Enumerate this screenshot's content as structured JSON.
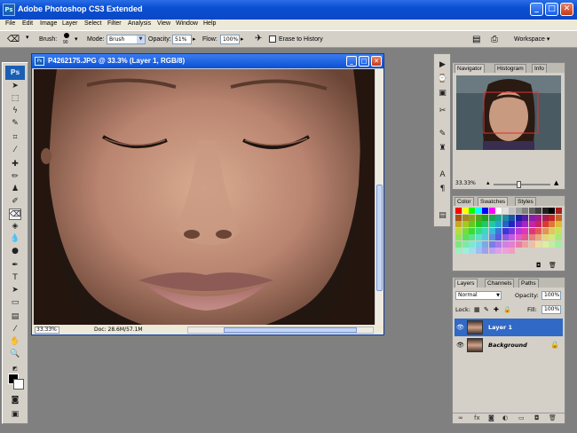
{
  "app": {
    "title": "Adobe Photoshop CS3 Extended"
  },
  "menu": [
    "File",
    "Edit",
    "Image",
    "Layer",
    "Select",
    "Filter",
    "Analysis",
    "View",
    "Window",
    "Help"
  ],
  "options": {
    "brush_label": "Brush:",
    "brush_size": "90",
    "mode_label": "Mode:",
    "mode_value": "Brush",
    "opacity_label": "Opacity:",
    "opacity_value": "51%",
    "flow_label": "Flow:",
    "flow_value": "100%",
    "erase_history": "Erase to History",
    "workspace": "Workspace ▾"
  },
  "document": {
    "title": "P4262175.JPG @ 33.3% (Layer 1, RGB/8)",
    "zoom": "33.33%",
    "doc_info": "Doc: 28.6M/57.1M"
  },
  "navigator": {
    "tabs": [
      "Navigator",
      "Histogram",
      "Info"
    ],
    "zoom": "33.33%"
  },
  "swatches": {
    "tabs": [
      "Color",
      "Swatches",
      "Styles"
    ]
  },
  "layers": {
    "tabs": [
      "Layers",
      "Channels",
      "Paths"
    ],
    "blend_mode": "Normal",
    "opacity_label": "Opacity:",
    "opacity_value": "100%",
    "lock_label": "Lock:",
    "fill_label": "Fill:",
    "fill_value": "100%",
    "items": [
      {
        "name": "Layer 1",
        "selected": true
      },
      {
        "name": "Background",
        "selected": false
      }
    ]
  },
  "colors": {
    "titlebar": "#0a4fd2",
    "chrome": "#d4d0c8",
    "workspace": "#808080",
    "selection": "#3169c6"
  }
}
